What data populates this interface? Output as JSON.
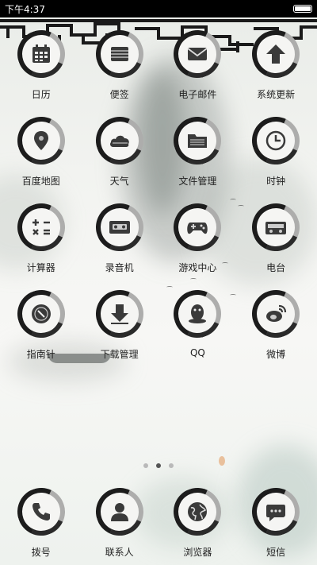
{
  "status_bar": {
    "time": "下午4:37",
    "battery_icon": "battery-icon"
  },
  "apps": [
    {
      "label": "日历",
      "icon": "calendar-icon"
    },
    {
      "label": "便签",
      "icon": "notes-icon"
    },
    {
      "label": "电子邮件",
      "icon": "email-icon"
    },
    {
      "label": "系统更新",
      "icon": "update-arrow-icon"
    },
    {
      "label": "百度地图",
      "icon": "map-pin-icon"
    },
    {
      "label": "天气",
      "icon": "cloud-icon"
    },
    {
      "label": "文件管理",
      "icon": "folder-icon"
    },
    {
      "label": "时钟",
      "icon": "clock-icon"
    },
    {
      "label": "计算器",
      "icon": "calculator-icon"
    },
    {
      "label": "录音机",
      "icon": "cassette-icon"
    },
    {
      "label": "游戏中心",
      "icon": "gamepad-icon"
    },
    {
      "label": "电台",
      "icon": "radio-icon"
    },
    {
      "label": "指南针",
      "icon": "compass-icon"
    },
    {
      "label": "下载管理",
      "icon": "download-icon"
    },
    {
      "label": "QQ",
      "icon": "penguin-icon"
    },
    {
      "label": "微博",
      "icon": "weibo-icon"
    }
  ],
  "pager": {
    "pages": 3,
    "active": 1
  },
  "dock": [
    {
      "label": "拨号",
      "icon": "phone-icon"
    },
    {
      "label": "联系人",
      "icon": "contact-icon"
    },
    {
      "label": "浏览器",
      "icon": "globe-icon"
    },
    {
      "label": "短信",
      "icon": "message-bubble-icon"
    }
  ],
  "colors": {
    "ink": "#1c1c1c",
    "status_bar": "#000000",
    "background": "#f3f4f1"
  }
}
